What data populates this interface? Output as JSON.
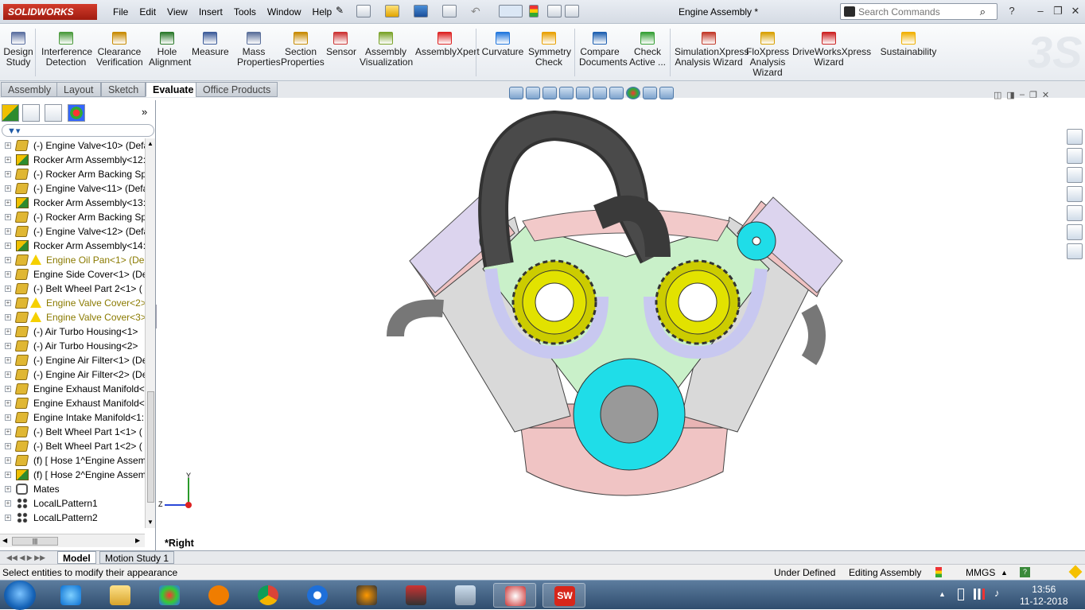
{
  "app": {
    "logo_text": "SOLIDWORKS",
    "doc_title": "Engine Assembly *"
  },
  "menu": [
    "File",
    "Edit",
    "View",
    "Insert",
    "Tools",
    "Window",
    "Help"
  ],
  "search": {
    "placeholder": "Search Commands"
  },
  "command_manager": [
    {
      "label": "Design\nStudy",
      "icon": "design-study-icon"
    },
    {
      "label": "Interference\nDetection",
      "icon": "interference-icon"
    },
    {
      "label": "Clearance\nVerification",
      "icon": "clearance-icon"
    },
    {
      "label": "Hole\nAlignment",
      "icon": "hole-alignment-icon"
    },
    {
      "label": "Measure",
      "icon": "measure-icon"
    },
    {
      "label": "Mass\nProperties",
      "icon": "mass-properties-icon"
    },
    {
      "label": "Section\nProperties",
      "icon": "section-properties-icon"
    },
    {
      "label": "Sensor",
      "icon": "sensor-icon"
    },
    {
      "label": "Assembly\nVisualization",
      "icon": "assembly-visualization-icon"
    },
    {
      "label": "AssemblyXpert",
      "icon": "assemblyxpert-icon"
    },
    {
      "label": "Curvature",
      "icon": "curvature-icon"
    },
    {
      "label": "Symmetry\nCheck",
      "icon": "symmetry-check-icon"
    },
    {
      "label": "Compare\nDocuments",
      "icon": "compare-icon"
    },
    {
      "label": "Check\nActive ...",
      "icon": "check-active-icon"
    },
    {
      "label": "SimulationXpress\nAnalysis Wizard",
      "icon": "simulationxpress-icon"
    },
    {
      "label": "FloXpress\nAnalysis\nWizard",
      "icon": "floxpress-icon"
    },
    {
      "label": "DriveWorksXpress\nWizard",
      "icon": "driveworks-icon"
    },
    {
      "label": "Sustainability",
      "icon": "sustainability-icon"
    }
  ],
  "tabs": [
    "Assembly",
    "Layout",
    "Sketch",
    "Evaluate",
    "Office Products"
  ],
  "active_tab": "Evaluate",
  "tree": [
    {
      "label": "(-) Engine Valve<10> (Defa",
      "type": "part",
      "warn": false
    },
    {
      "label": "Rocker Arm Assembly<12:",
      "type": "asm",
      "warn": false
    },
    {
      "label": "(-) Rocker Arm Backing Sp",
      "type": "part",
      "warn": false
    },
    {
      "label": "(-) Engine Valve<11> (Defa",
      "type": "part",
      "warn": false
    },
    {
      "label": "Rocker Arm Assembly<13:",
      "type": "asm",
      "warn": false
    },
    {
      "label": "(-) Rocker Arm Backing Sp",
      "type": "part",
      "warn": false
    },
    {
      "label": "(-) Engine Valve<12> (Defa",
      "type": "part",
      "warn": false
    },
    {
      "label": "Rocker Arm Assembly<14:",
      "type": "asm",
      "warn": false
    },
    {
      "label": "Engine Oil Pan<1> (De",
      "type": "part",
      "warn": true
    },
    {
      "label": "Engine Side Cover<1> (De",
      "type": "part",
      "warn": false
    },
    {
      "label": "(-) Belt Wheel Part  2<1> (",
      "type": "part",
      "warn": false
    },
    {
      "label": "Engine Valve Cover<2>",
      "type": "part",
      "warn": true
    },
    {
      "label": "Engine Valve Cover<3>",
      "type": "part",
      "warn": true
    },
    {
      "label": "(-) Air Turbo Housing<1>",
      "type": "part",
      "warn": false
    },
    {
      "label": "(-) Air Turbo Housing<2>",
      "type": "part",
      "warn": false
    },
    {
      "label": "(-) Engine Air Filter<1> (De",
      "type": "part",
      "warn": false
    },
    {
      "label": "(-) Engine Air Filter<2> (De",
      "type": "part",
      "warn": false
    },
    {
      "label": "Engine Exhaust Manifold<",
      "type": "part",
      "warn": false
    },
    {
      "label": "Engine Exhaust Manifold<",
      "type": "part",
      "warn": false
    },
    {
      "label": "Engine Intake Manifold<1:",
      "type": "part",
      "warn": false
    },
    {
      "label": "(-) Belt Wheel Part  1<1> (",
      "type": "part",
      "warn": false
    },
    {
      "label": "(-) Belt Wheel Part  1<2> (",
      "type": "part",
      "warn": false
    },
    {
      "label": "(f) [ Hose 1^Engine Assem",
      "type": "part",
      "warn": false
    },
    {
      "label": "(f) [ Hose 2^Engine Assem",
      "type": "asm",
      "warn": false
    },
    {
      "label": "Mates",
      "type": "mate",
      "warn": false
    },
    {
      "label": "LocalLPattern1",
      "type": "pat",
      "warn": false
    },
    {
      "label": "LocalLPattern2",
      "type": "pat",
      "warn": false
    }
  ],
  "viewport": {
    "view_label": "*Right",
    "triad_y": "Y",
    "triad_z": "Z"
  },
  "bottom_tabs": [
    "Model",
    "Motion Study 1"
  ],
  "status": {
    "message": "Select entities to modify their appearance",
    "definition": "Under Defined",
    "mode": "Editing Assembly",
    "units": "MMGS"
  },
  "taskbar": {
    "time": "13:56",
    "date": "11-12-2018"
  }
}
